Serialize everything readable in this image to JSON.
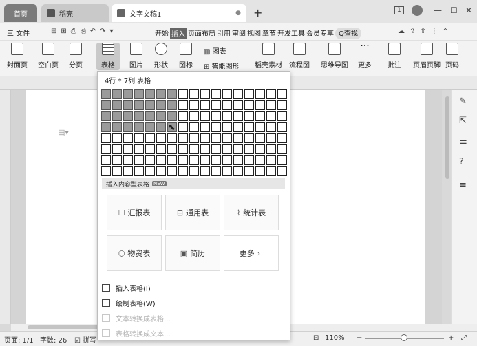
{
  "tabs": {
    "home": "首页",
    "docer": "稻壳",
    "doc": "文字文稿1",
    "close": "●"
  },
  "window": {
    "page_badge": "1",
    "min": "—",
    "max": "☐",
    "close": "✕"
  },
  "menu": {
    "file": "三 文件",
    "items": [
      "开始",
      "插入",
      "页面布局",
      "引用",
      "审阅",
      "视图",
      "章节",
      "开发工具",
      "会员专享"
    ],
    "search": "Q查找"
  },
  "ribbon": {
    "cover": "封面页",
    "blank": "空白页",
    "break": "分页",
    "table": "表格",
    "picture": "图片",
    "shape": "形状",
    "icon": "图标",
    "chart": "图表",
    "smartart": "智能图形",
    "docer_material": "稻壳素材",
    "flowchart": "流程图",
    "mindmap": "思维导图",
    "more": "更多",
    "comment": "批注",
    "header_footer": "页眉页脚",
    "page_number": "页码"
  },
  "dropdown": {
    "title": "4行 * 7列 表格",
    "rows_selected": 4,
    "cols_selected": 7,
    "content_tables_label": "插入内容型表格",
    "badge": "NEW",
    "templates": [
      "汇报表",
      "通用表",
      "统计表",
      "物资表",
      "简历",
      "更多"
    ],
    "insert_table": "插入表格(I)",
    "draw_table": "绘制表格(W)",
    "text_to_table": "文本转换成表格...",
    "table_to_text": "表格转换成文本..."
  },
  "status": {
    "page": "页面: 1/1",
    "words": "字数: 26",
    "spell": "拼写",
    "zoom": "110%"
  },
  "colors": {
    "selected_cell": "#9a9a9a",
    "home_tab": "#7b7b7b"
  }
}
